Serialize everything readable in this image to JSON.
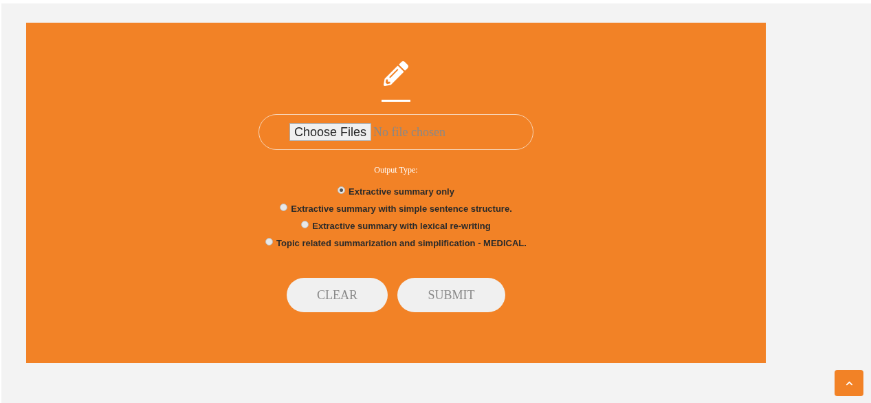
{
  "upload": {
    "button": "Choose Files",
    "status": "No file chosen"
  },
  "output_type": {
    "label": "Output Type:",
    "options": [
      {
        "label": "Extractive summary only",
        "selected": true
      },
      {
        "label": "Extractive summary with simple sentence structure.",
        "selected": false
      },
      {
        "label": "Extractive summary with lexical re-writing",
        "selected": false
      },
      {
        "label": "Topic related summarization and simplification - MEDICAL.",
        "selected": false
      }
    ]
  },
  "buttons": [
    "CLEAR",
    "SUBMIT"
  ]
}
